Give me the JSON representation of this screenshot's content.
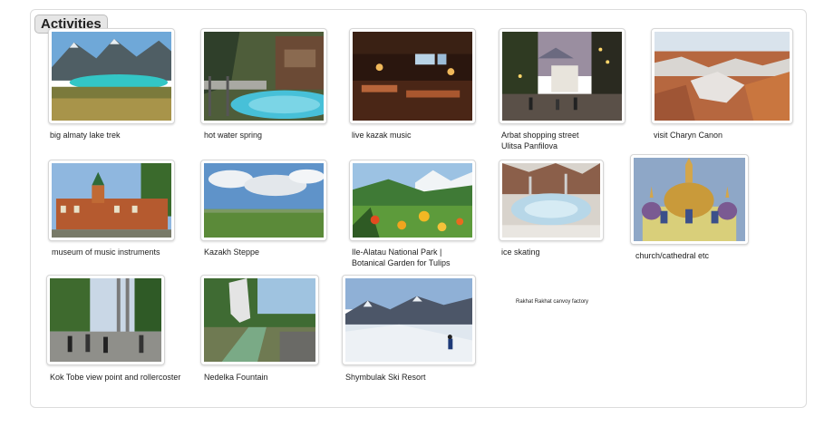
{
  "board": {
    "title": "Activities"
  },
  "cards": [
    {
      "caption": "big almaty lake trek"
    },
    {
      "caption": "hot water spring"
    },
    {
      "caption": "live kazak music"
    },
    {
      "caption_lines": [
        "Arbat shopping street",
        "Ulitsa Panfilova"
      ]
    },
    {
      "caption": "visit Charyn Canon"
    },
    {
      "caption": "museum of music instruments"
    },
    {
      "caption": "Kazakh Steppe"
    },
    {
      "caption_lines": [
        "Ile-Alatau National Park |",
        "Botanical Garden for Tulips"
      ]
    },
    {
      "caption": "ice skating"
    },
    {
      "caption": "church/cathedral etc"
    },
    {
      "caption": "Kok Tobe view point and rollercoster"
    },
    {
      "caption": "Nedelka Fountain"
    },
    {
      "caption": "Shymbulak Ski Resort"
    }
  ],
  "note": {
    "text": "Rakhat Rakhat  canvoy factory"
  }
}
